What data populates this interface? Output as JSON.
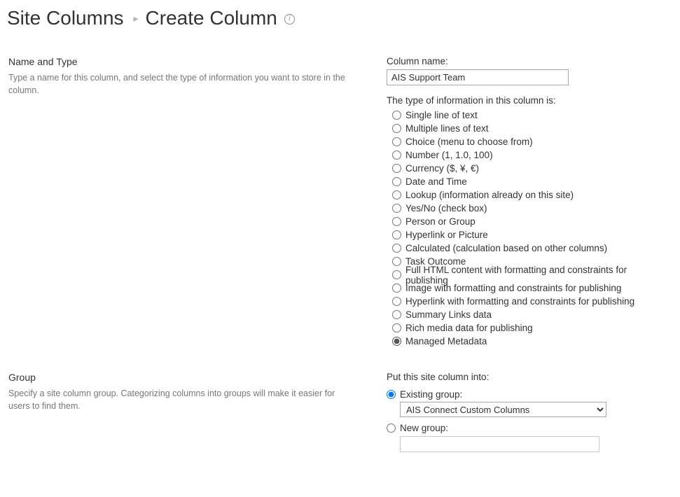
{
  "header": {
    "breadcrumb": "Site Columns",
    "separator": "▸",
    "title": "Create Column",
    "info_glyph": "i"
  },
  "nameType": {
    "heading": "Name and Type",
    "description": "Type a name for this column, and select the type of information you want to store in the column.",
    "columnNameLabel": "Column name:",
    "columnNameValue": "AIS Support Team",
    "typeLabel": "The type of information in this column is:",
    "types": [
      "Single line of text",
      "Multiple lines of text",
      "Choice (menu to choose from)",
      "Number (1, 1.0, 100)",
      "Currency ($, ¥, €)",
      "Date and Time",
      "Lookup (information already on this site)",
      "Yes/No (check box)",
      "Person or Group",
      "Hyperlink or Picture",
      "Calculated (calculation based on other columns)",
      "Task Outcome",
      "Full HTML content with formatting and constraints for publishing",
      "Image with formatting and constraints for publishing",
      "Hyperlink with formatting and constraints for publishing",
      "Summary Links data",
      "Rich media data for publishing",
      "Managed Metadata"
    ],
    "selectedTypeIndex": 17
  },
  "group": {
    "heading": "Group",
    "description": "Specify a site column group. Categorizing columns into groups will make it easier for users to find them.",
    "putIntoLabel": "Put this site column into:",
    "existingLabel": "Existing group:",
    "existingSelected": "AIS Connect Custom Columns",
    "newLabel": "New group:",
    "newValue": "",
    "selected": "existing"
  }
}
